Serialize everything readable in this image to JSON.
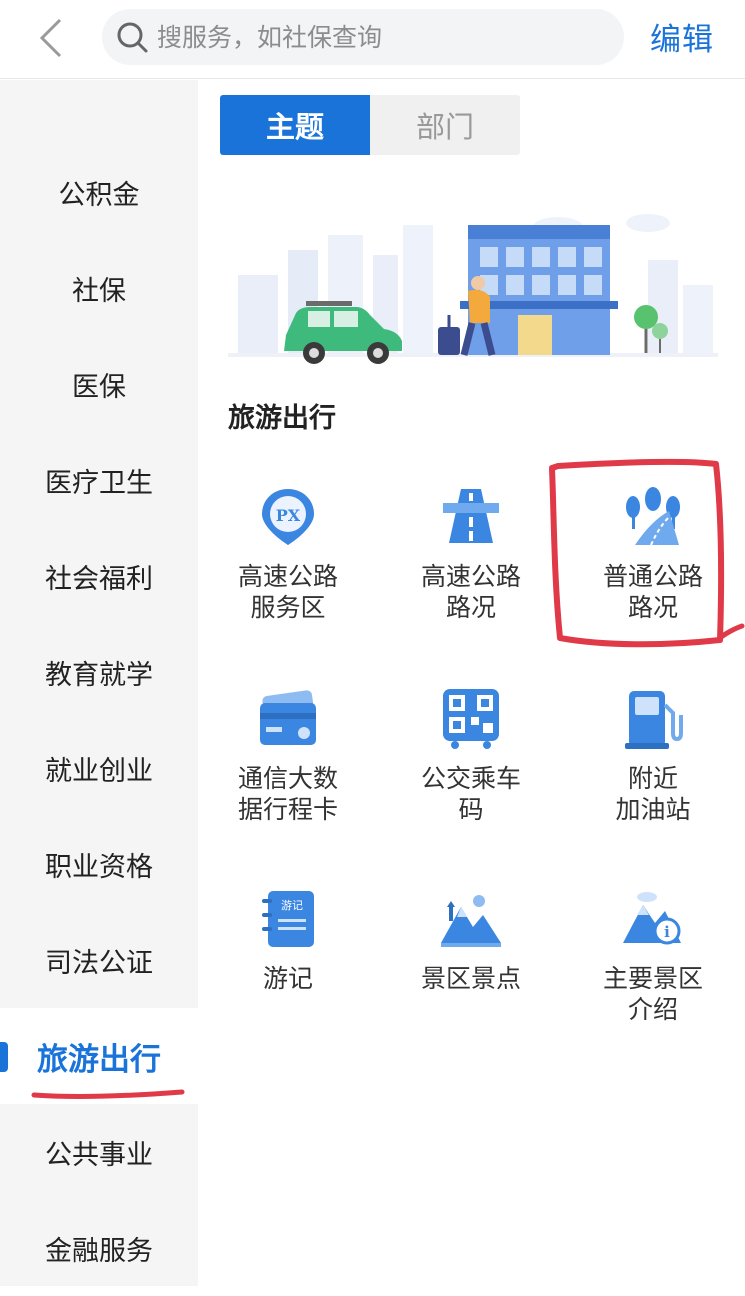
{
  "header": {
    "search_placeholder": "搜服务，如社保查询",
    "edit_label": "编辑"
  },
  "tabs": [
    {
      "label": "主题",
      "active": true
    },
    {
      "label": "部门",
      "active": false
    }
  ],
  "sidebar": {
    "items": [
      {
        "label": "公积金"
      },
      {
        "label": "社保"
      },
      {
        "label": "医保"
      },
      {
        "label": "医疗卫生"
      },
      {
        "label": "社会福利"
      },
      {
        "label": "教育就学"
      },
      {
        "label": "就业创业"
      },
      {
        "label": "职业资格"
      },
      {
        "label": "司法公证"
      },
      {
        "label": "旅游出行",
        "active": true
      },
      {
        "label": "公共事业"
      },
      {
        "label": "金融服务"
      }
    ]
  },
  "section": {
    "title": "旅游出行",
    "services": [
      {
        "label": "高速公路\n服务区",
        "icon": "service-area-px-icon"
      },
      {
        "label": "高速公路\n路况",
        "icon": "highway-road-icon"
      },
      {
        "label": "普通公路\n路况",
        "icon": "ordinary-road-trees-icon"
      },
      {
        "label": "通信大数\n据行程卡",
        "icon": "travel-card-icon"
      },
      {
        "label": "公交乘车\n码",
        "icon": "bus-qr-code-icon"
      },
      {
        "label": "附近\n加油站",
        "icon": "gas-station-icon"
      },
      {
        "label": "游记",
        "icon": "travel-notes-icon",
        "badge": "游记"
      },
      {
        "label": "景区景点",
        "icon": "scenic-spot-icon"
      },
      {
        "label": "主要景区\n介绍",
        "icon": "scenic-intro-icon",
        "badge": "i"
      }
    ]
  },
  "colors": {
    "accent": "#1a73d9",
    "annotation": "#e03a48"
  }
}
